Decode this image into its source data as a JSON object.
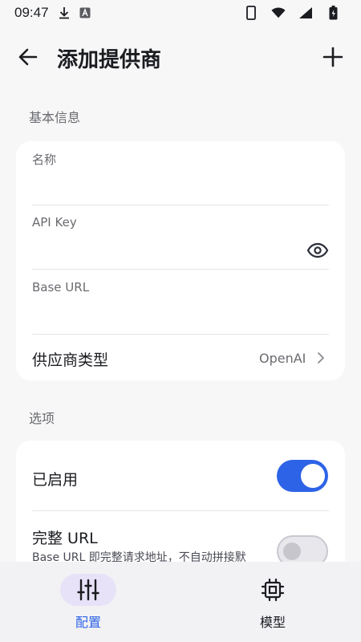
{
  "status_bar": {
    "time": "09:47",
    "icons": [
      "download-icon",
      "a-badge-icon",
      "phone-icon",
      "wifi-icon",
      "signal-icon",
      "battery-icon"
    ]
  },
  "header": {
    "title": "添加提供商",
    "back_icon": "arrow-left-icon",
    "add_icon": "plus-icon"
  },
  "basic_info": {
    "section_label": "基本信息",
    "name_label": "名称",
    "name_value": "",
    "api_key_label": "API Key",
    "api_key_value": "",
    "base_url_label": "Base URL",
    "base_url_value": "",
    "provider_type_label": "供应商类型",
    "provider_type_value": "OpenAI"
  },
  "options": {
    "section_label": "选项",
    "enabled_label": "已启用",
    "enabled": true,
    "full_url_label": "完整 URL",
    "full_url_desc": "Base URL 即完整请求地址，不自动拼接默",
    "full_url_enabled": false
  },
  "bottom_nav": {
    "items": [
      {
        "label": "配置",
        "icon": "sliders-icon",
        "active": true
      },
      {
        "label": "模型",
        "icon": "chip-icon",
        "active": false
      }
    ]
  },
  "colors": {
    "accent": "#2d63e6",
    "active_pill": "#e7e2f7",
    "active_label": "#2d63e6",
    "background": "#f7f7f8"
  }
}
